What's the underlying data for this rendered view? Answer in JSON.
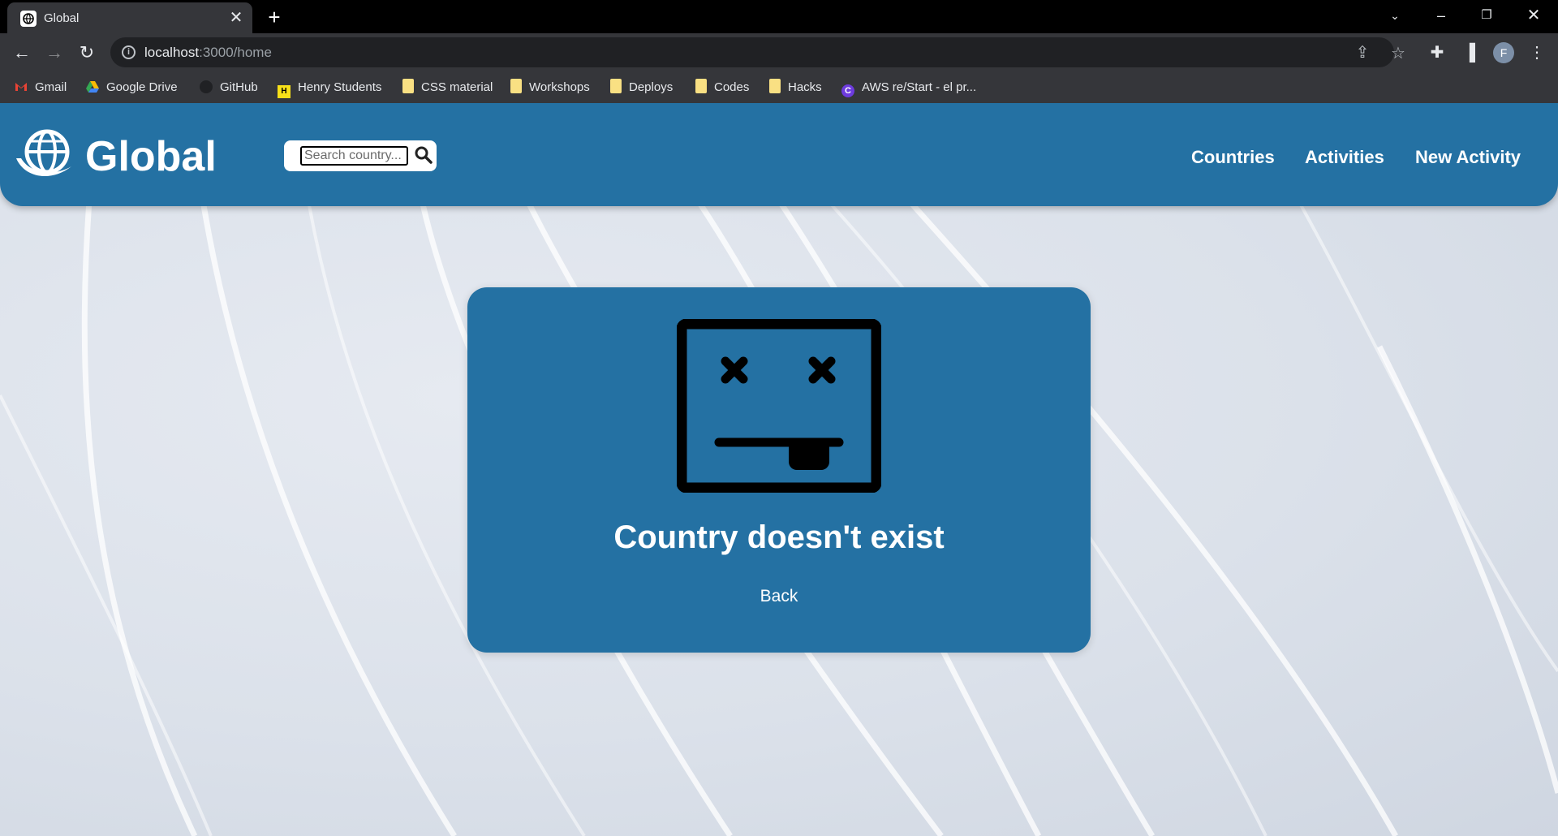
{
  "browser": {
    "tab_title": "Global",
    "url_host": "localhost",
    "url_rest": ":3000/home",
    "profile_initial": "F",
    "bookmarks": [
      {
        "label": "Gmail",
        "icon": "gmail-icon"
      },
      {
        "label": "Google Drive",
        "icon": "google-drive-icon"
      },
      {
        "label": "GitHub",
        "icon": "github-icon"
      },
      {
        "label": "Henry Students",
        "icon": "henry-icon"
      },
      {
        "label": "CSS material",
        "icon": "folder-icon"
      },
      {
        "label": "Workshops",
        "icon": "folder-icon"
      },
      {
        "label": "Deploys",
        "icon": "folder-icon"
      },
      {
        "label": "Codes",
        "icon": "folder-icon"
      },
      {
        "label": "Hacks",
        "icon": "folder-icon"
      },
      {
        "label": "AWS re/Start - el pr...",
        "icon": "aws-restart-icon"
      }
    ]
  },
  "app": {
    "brand": "Global",
    "search": {
      "placeholder": "Search country..."
    },
    "nav": [
      "Countries",
      "Activities",
      "New Activity"
    ],
    "error": {
      "message": "Country doesn't exist",
      "back_label": "Back"
    },
    "colors": {
      "primary": "#2471a3",
      "background": "#dde3ec"
    }
  }
}
